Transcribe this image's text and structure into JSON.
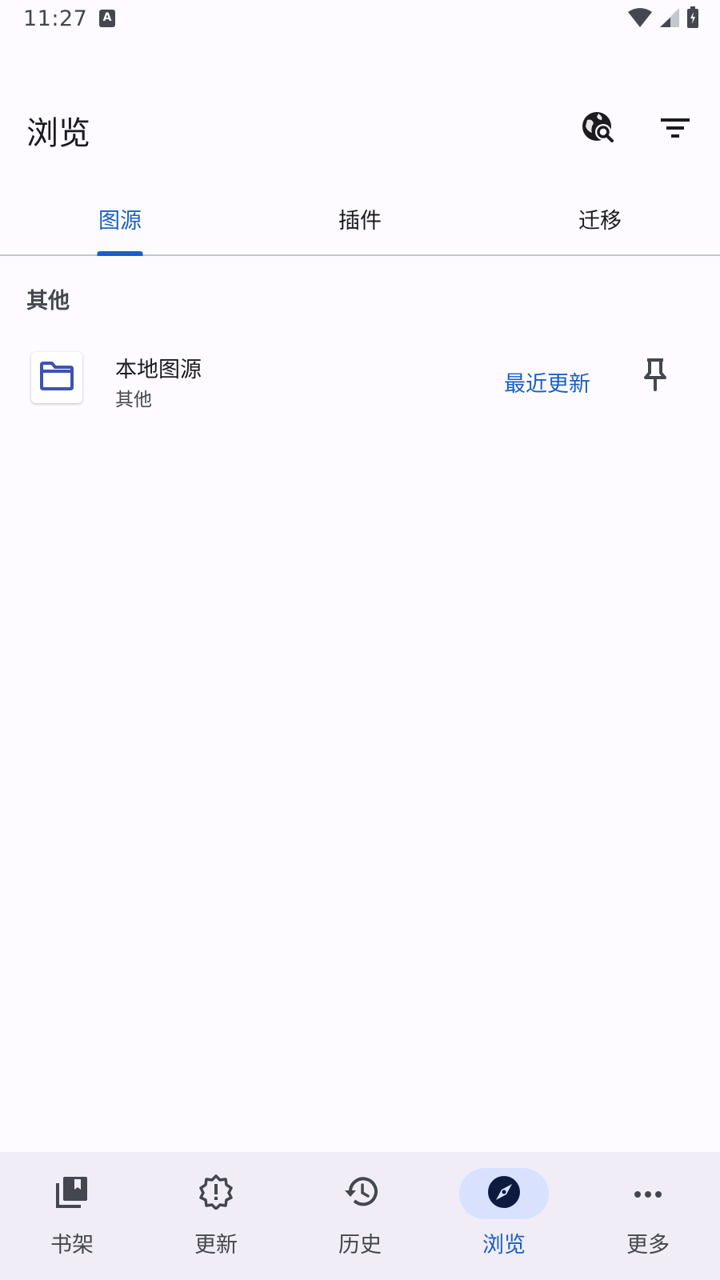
{
  "status_bar": {
    "time": "11:27",
    "notification_icon": "a-icon",
    "icons": [
      "wifi-icon",
      "signal-icon",
      "battery-icon"
    ]
  },
  "app_bar": {
    "title": "浏览",
    "actions": [
      "globe-search-icon",
      "filter-icon"
    ]
  },
  "tabs": [
    {
      "label": "图源",
      "active": true
    },
    {
      "label": "插件",
      "active": false
    },
    {
      "label": "迁移",
      "active": false
    }
  ],
  "section": {
    "label": "其他",
    "sources": [
      {
        "name": "本地图源",
        "language": "其他",
        "icon": "folder-icon",
        "latest_label": "最近更新",
        "pin_icon": "pin-icon"
      }
    ]
  },
  "bottom_nav": [
    {
      "label": "书架",
      "icon": "library-icon",
      "active": false
    },
    {
      "label": "更新",
      "icon": "alert-badge-icon",
      "active": false
    },
    {
      "label": "历史",
      "icon": "history-icon",
      "active": false
    },
    {
      "label": "浏览",
      "icon": "compass-icon",
      "active": true
    },
    {
      "label": "更多",
      "icon": "more-horiz-icon",
      "active": false
    }
  ],
  "colors": {
    "accent": "#1a5fc4",
    "background": "#fdfbff",
    "nav_background": "#f1edf6",
    "nav_active_pill": "#d8e2ff",
    "folder": "#3f51b5"
  }
}
